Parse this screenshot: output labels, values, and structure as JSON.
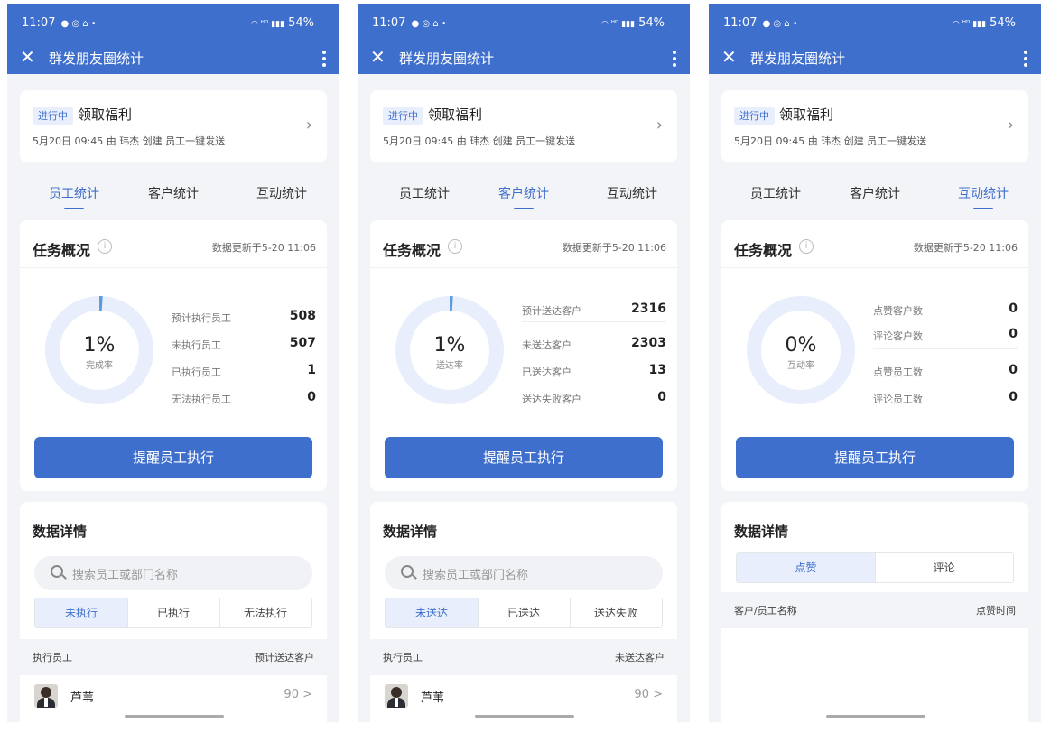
{
  "status": {
    "time": "11:07",
    "left_icons": "● ◎ ⌂ •",
    "right_icons": "◠ ᴴᴰ ▮▮▮",
    "battery": "54%"
  },
  "colors": {
    "primary": "#3f6fcc",
    "ring": "#e8eefc",
    "background": "#f3f4f7"
  },
  "screens": [
    {
      "nav_title": "群发朋友圈统计",
      "task": {
        "badge": "进行中",
        "title": "领取福利",
        "meta": "5月20日 09:45 由 玮杰 创建 员工一键发送"
      },
      "tabs": [
        "员工统计",
        "客户统计",
        "互动统计"
      ],
      "active_tab": 0,
      "overview": {
        "title": "任务概况",
        "update": "数据更新于5-20 11:06",
        "percent": "1%",
        "percent_label": "完成率",
        "rate": 0.01,
        "stats": [
          {
            "label": "预计执行员工",
            "value": "508"
          },
          {
            "label": "未执行员工",
            "value": "507"
          },
          {
            "label": "已执行员工",
            "value": "1"
          },
          {
            "label": "无法执行员工",
            "value": "0"
          }
        ],
        "button": "提醒员工执行"
      },
      "detail": {
        "title": "数据详情",
        "search_placeholder": "搜索员工或部门名称",
        "segments": [
          "未执行",
          "已执行",
          "无法执行"
        ],
        "col_left": "执行员工",
        "col_right": "预计送达客户",
        "rows": [
          {
            "name": "芦苇",
            "value": "90 >"
          }
        ]
      }
    },
    {
      "nav_title": "群发朋友圈统计",
      "task": {
        "badge": "进行中",
        "title": "领取福利",
        "meta": "5月20日 09:45 由 玮杰 创建 员工一键发送"
      },
      "tabs": [
        "员工统计",
        "客户统计",
        "互动统计"
      ],
      "active_tab": 1,
      "overview": {
        "title": "任务概况",
        "update": "数据更新于5-20 11:06",
        "percent": "1%",
        "percent_label": "送达率",
        "rate": 0.01,
        "stats": [
          {
            "label": "预计送达客户",
            "value": "2316"
          },
          {
            "label": "未送达客户",
            "value": "2303"
          },
          {
            "label": "已送达客户",
            "value": "13"
          },
          {
            "label": "送达失败客户",
            "value": "0"
          }
        ],
        "button": "提醒员工执行"
      },
      "detail": {
        "title": "数据详情",
        "search_placeholder": "搜索员工或部门名称",
        "segments": [
          "未送达",
          "已送达",
          "送达失败"
        ],
        "col_left": "执行员工",
        "col_right": "未送达客户",
        "rows": [
          {
            "name": "芦苇",
            "value": "90 >"
          }
        ]
      }
    },
    {
      "nav_title": "群发朋友圈统计",
      "task": {
        "badge": "进行中",
        "title": "领取福利",
        "meta": "5月20日 09:45 由 玮杰 创建 员工一键发送"
      },
      "tabs": [
        "员工统计",
        "客户统计",
        "互动统计"
      ],
      "active_tab": 2,
      "overview": {
        "title": "任务概况",
        "update": "数据更新于5-20 11:06",
        "percent": "0%",
        "percent_label": "互动率",
        "rate": 0,
        "stats": [
          {
            "label": "点赞客户数",
            "value": "0"
          },
          {
            "label": "评论客户数",
            "value": "0"
          },
          {
            "label": "点赞员工数",
            "value": "0"
          },
          {
            "label": "评论员工数",
            "value": "0"
          }
        ],
        "button": "提醒员工执行"
      },
      "detail": {
        "title": "数据详情",
        "segments": [
          "点赞",
          "评论"
        ],
        "col_left": "客户/员工名称",
        "col_right": "点赞时间",
        "rows": []
      }
    }
  ]
}
